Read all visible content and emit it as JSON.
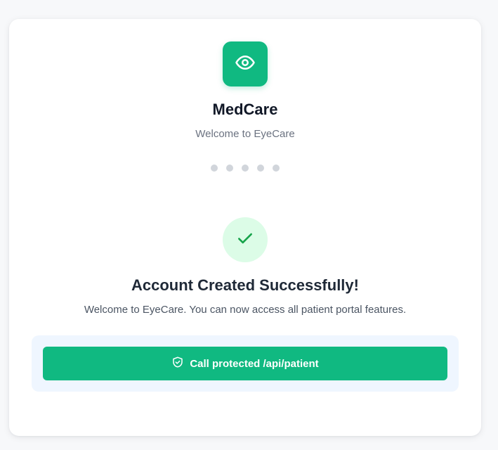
{
  "brand": {
    "name": "MedCare",
    "tagline": "Welcome to EyeCare",
    "logo_icon": "eye-icon"
  },
  "progress": {
    "step_count": 5
  },
  "success": {
    "icon": "check-icon",
    "title": "Account Created Successfully!",
    "message": "Welcome to EyeCare. You can now access all patient portal features."
  },
  "action": {
    "button_label": "Call protected /api/patient",
    "button_icon": "shield-check-icon"
  },
  "colors": {
    "accent": "#10b981",
    "success_bg": "#dcfce7",
    "success_check": "#16a34a",
    "panel_bg": "#eff6ff",
    "dot": "#d1d5db"
  }
}
